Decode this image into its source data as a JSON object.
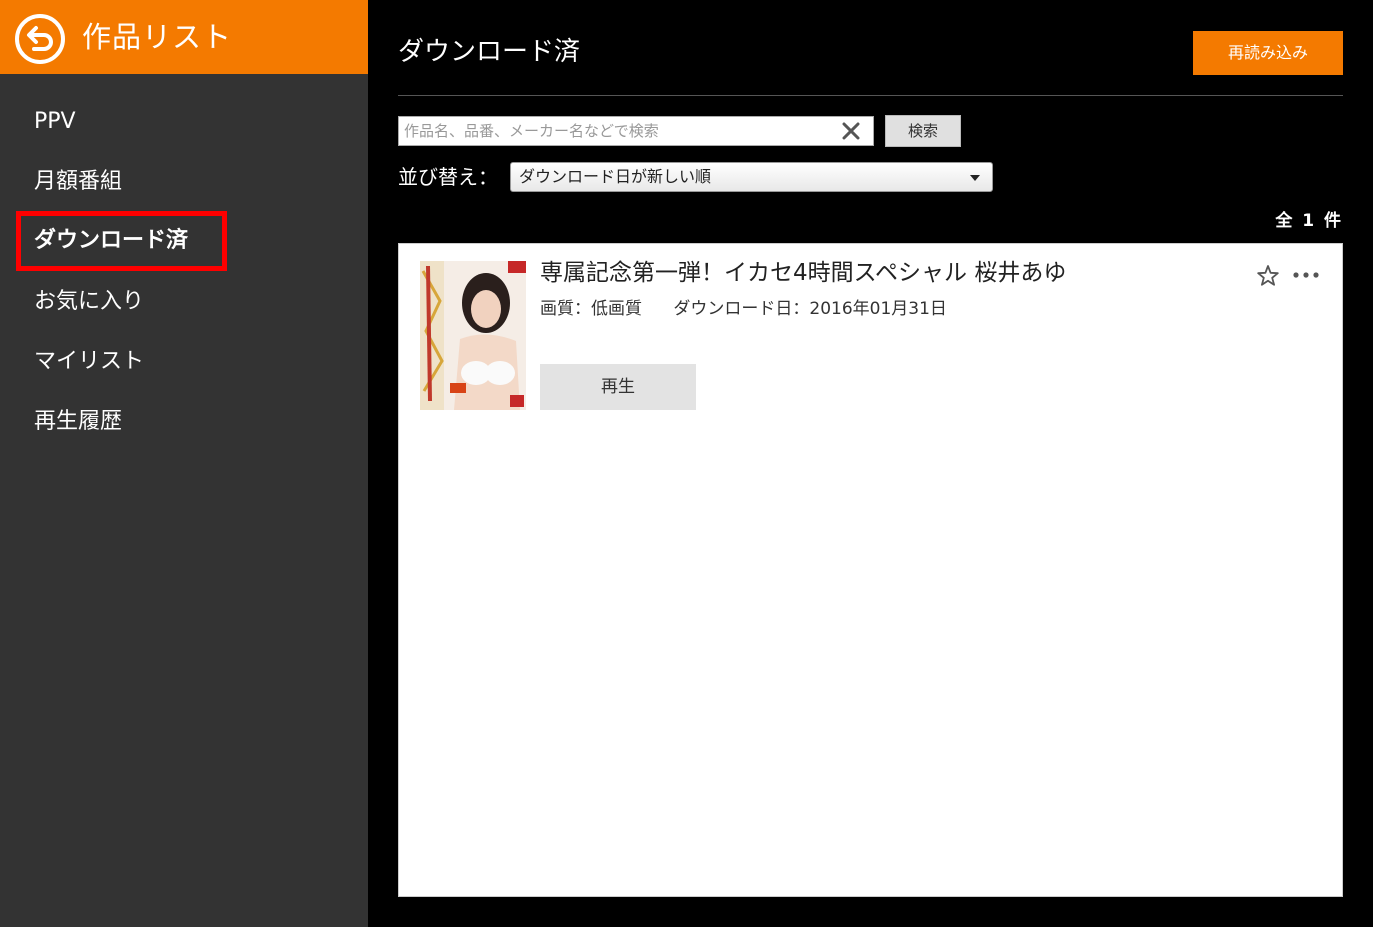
{
  "sidebar": {
    "title": "作品リスト",
    "items": [
      {
        "label": "PPV"
      },
      {
        "label": "月額番組"
      },
      {
        "label": "ダウンロード済"
      },
      {
        "label": "お気に入り"
      },
      {
        "label": "マイリスト"
      },
      {
        "label": "再生履歴"
      }
    ],
    "active_index": 2
  },
  "main": {
    "title": "ダウンロード済",
    "reload_label": "再読み込み",
    "search": {
      "value": "",
      "placeholder": "作品名、品番、メーカー名などで検索",
      "button_label": "検索"
    },
    "sort": {
      "label": "並び替え：",
      "selected": "ダウンロード日が新しい順"
    },
    "count_label": "全 1 件",
    "items": [
      {
        "title": "専属記念第一弾！イカセ4時間スペシャル 桜井あゆ",
        "quality": "画質：低画質",
        "download_date": "ダウンロード日：2016年01月31日",
        "play_label": "再生"
      }
    ]
  },
  "colors": {
    "accent": "#f47a00",
    "sidebar_bg": "#333333",
    "main_bg": "#000000",
    "highlight_border": "#ff0000"
  },
  "icons": {
    "back": "back-arrow-circle-icon",
    "clear": "close-icon",
    "favorite": "star-outline-icon",
    "more": "more-dots-icon"
  }
}
